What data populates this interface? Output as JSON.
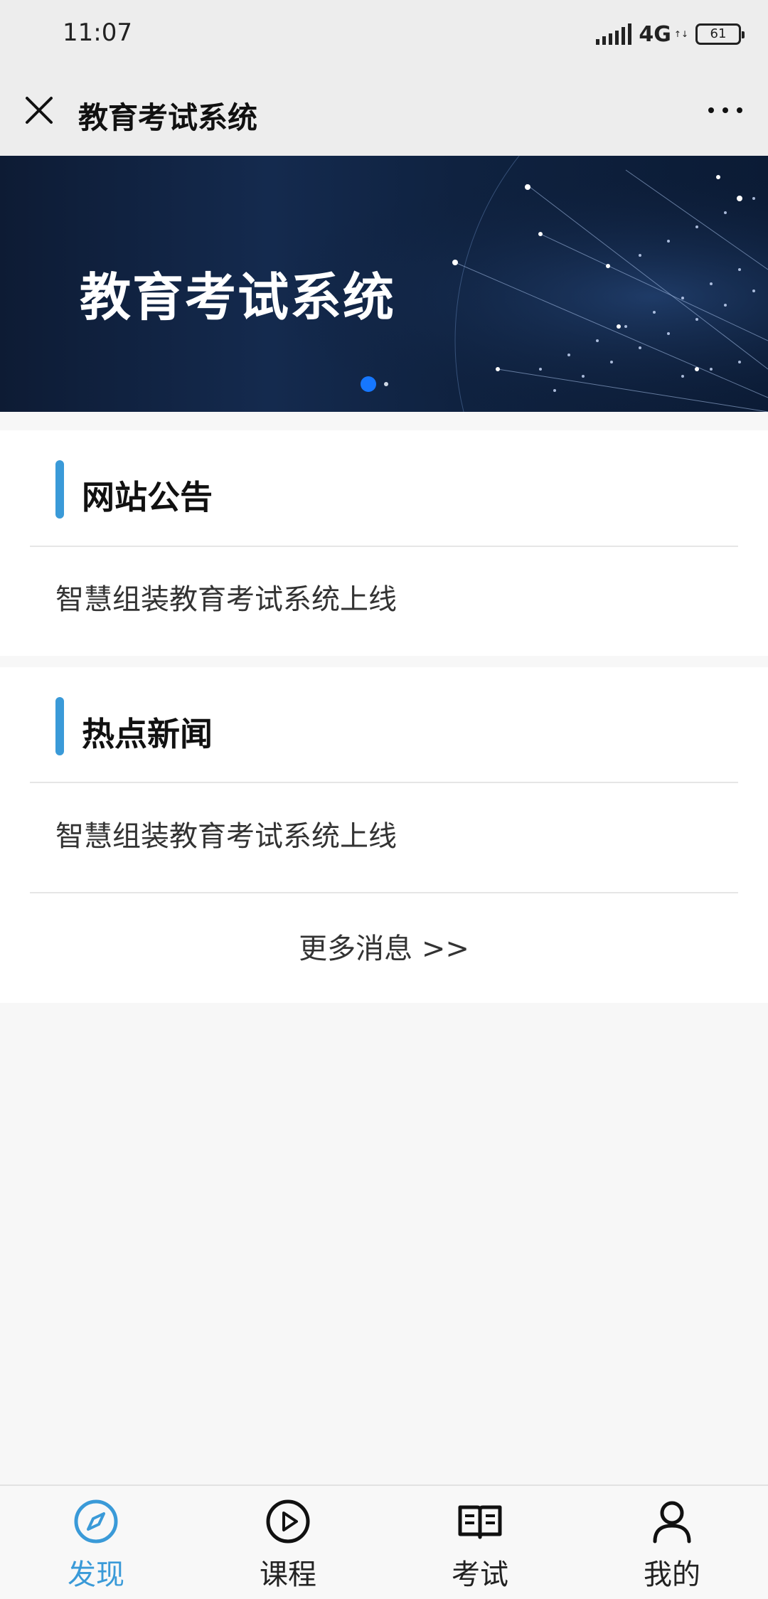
{
  "status_bar": {
    "time": "11:07",
    "network": "4G",
    "battery": "61"
  },
  "header": {
    "title": "教育考试系统",
    "close_icon": "close-icon",
    "more_icon": "more-icon"
  },
  "banner": {
    "title": "教育考试系统",
    "slide_count": 2,
    "active_slide": 1
  },
  "announcements": {
    "title": "网站公告",
    "items": [
      {
        "text": "智慧组装教育考试系统上线"
      }
    ]
  },
  "hot_news": {
    "title": "热点新闻",
    "items": [
      {
        "text": "智慧组装教育考试系统上线"
      }
    ],
    "more_label": "更多消息 >>"
  },
  "tabbar": {
    "tabs": [
      {
        "label": "发现",
        "icon": "compass-icon",
        "active": true
      },
      {
        "label": "课程",
        "icon": "play-circle-icon",
        "active": false
      },
      {
        "label": "考试",
        "icon": "book-icon",
        "active": false
      },
      {
        "label": "我的",
        "icon": "user-icon",
        "active": false
      }
    ]
  },
  "colors": {
    "accent": "#3a9ad8",
    "banner_bg": "#0f2240",
    "page_bg": "#f7f7f7"
  }
}
